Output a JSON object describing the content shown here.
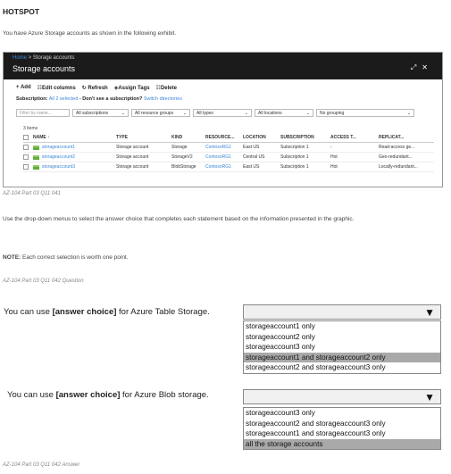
{
  "heading": "HOTSPOT",
  "intro": "You have Azure Storage accounts as shown in the following exhibit.",
  "exhibit": {
    "breadcrumb_home": "Home",
    "breadcrumb_rest": " > Storage accounts",
    "title": "Storage accounts",
    "header_icons": [
      "pin-icon",
      "close-icon"
    ],
    "pin_glyph": "⤢",
    "close_glyph": "✕",
    "toolbar": {
      "add": "+ Add",
      "edit_columns": "☷Edit columns",
      "refresh": "↻ Refresh",
      "assign_tags": "◈Assign Tags",
      "delete": "☷Delete"
    },
    "subscription_label": "Subscription:",
    "subscription_selected": "All 2 selected",
    "subscription_hint": " - Don't see a subscription?",
    "switch_directories": "Switch directories",
    "filters": {
      "filter_placeholder": "Filter by name...",
      "subscriptions": "All subscriptions",
      "resource_groups": "All resource groups",
      "types": "All types",
      "locations": "All locations",
      "grouping": "No grouping"
    },
    "items_count": "3 items",
    "columns": [
      "NAME ↑",
      "TYPE",
      "KIND",
      "RESOURCE...",
      "LOCATION",
      "SUBSCRIPTION",
      "ACCESS T...",
      "REPLICAT..."
    ],
    "rows": [
      {
        "name": "storageaccount1",
        "type": "Storage account",
        "kind": "Storage",
        "resource": "ContosoRG1",
        "location": "East US",
        "subscription": "Subscription 1",
        "access": "-",
        "replication": "Read-access ge..."
      },
      {
        "name": "storageaccount2",
        "type": "Storage account",
        "kind": "StorageV2",
        "resource": "ContosoRG1",
        "location": "Central US",
        "subscription": "Subscription 1",
        "access": "Hot",
        "replication": "Geo-redundant..."
      },
      {
        "name": "storageaccount3",
        "type": "Storage account",
        "kind": "BlobStorage",
        "resource": "ContosoRG1",
        "location": "East US",
        "subscription": "Subscription 1",
        "access": "Hot",
        "replication": "Locally-redundant..."
      }
    ]
  },
  "caption1": "AZ-104 Part 03 Q11 041",
  "instruction": "Use the drop-down menus to select the answer choice that completes each statement based on the information presented in the graphic.",
  "note_label": "NOTE:",
  "note_text": " Each correct selection is worth one point.",
  "caption2": "AZ-104 Part 03 Q11 042 Question",
  "answer_area": {
    "q1": {
      "prefix": "You can use ",
      "bold": "[answer choice]",
      "suffix": " for Azure Table Storage.",
      "options": [
        "storageaccount1 only",
        "storageaccount2 only",
        "storageaccount3 only",
        "storageaccount1 and storageaccount2 only",
        "storageaccount2 and storageaccount3 only"
      ],
      "selected_index": 3
    },
    "q2": {
      "prefix": "You can use ",
      "bold": "[answer choice]",
      "suffix": " for Azure Blob storage.",
      "options": [
        "storageaccount3 only",
        "storageaccount2 and storageaccount3 only",
        "storageaccount1 and storageaccount3 only",
        "all the storage accounts"
      ],
      "selected_index": 3
    },
    "arrow_glyph": "▼"
  },
  "caption3": "AZ-104 Part 03 Q11 042 Answer"
}
